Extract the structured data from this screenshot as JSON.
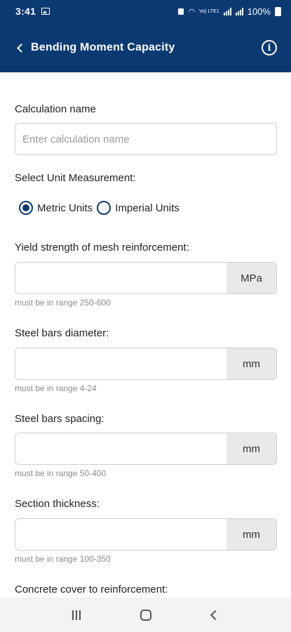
{
  "status_bar": {
    "time": "3:41",
    "battery": "100%",
    "volte_label": "Vo) LTE1"
  },
  "toolbar": {
    "title": "Bending Moment Capacity"
  },
  "form": {
    "calc_name": {
      "label": "Calculation name",
      "placeholder": "Enter calculation name",
      "value": ""
    },
    "units": {
      "label": "Select Unit Measurement:",
      "options": [
        "Metric Units",
        "Imperial Units"
      ],
      "selected": "Metric Units"
    },
    "fields": [
      {
        "label": "Yield strength of mesh reinforcement:",
        "unit": "MPa",
        "hint": "must be in range 250-600",
        "value": ""
      },
      {
        "label": "Steel bars diameter:",
        "unit": "mm",
        "hint": "must be in range 4-24",
        "value": ""
      },
      {
        "label": "Steel bars spacing:",
        "unit": "mm",
        "hint": "must be in range 50-400",
        "value": ""
      },
      {
        "label": "Section thickness:",
        "unit": "mm",
        "hint": "must be in range 100-350",
        "value": ""
      }
    ],
    "next_label": "Concrete cover to reinforcement:"
  },
  "icons": {
    "back": "chevron-left-icon",
    "info": "info-icon",
    "nav_recent": "recent-apps-icon",
    "nav_home": "home-icon",
    "nav_back": "back-icon"
  },
  "colors": {
    "primary": "#0b3a73",
    "unit_bg": "#e9e9e9",
    "hint": "#8a8a8a"
  }
}
